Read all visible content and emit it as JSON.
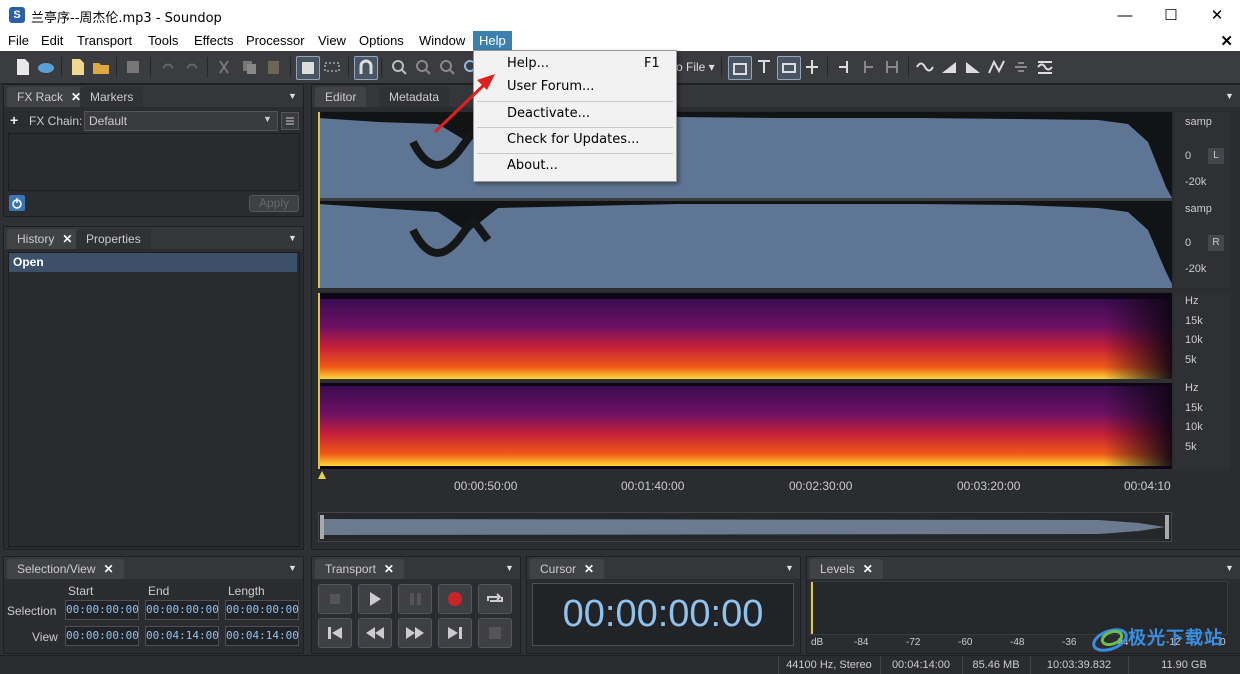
{
  "window": {
    "title": "兰亭序--周杰伦.mp3 - Soundop",
    "app_icon_letter": "S",
    "minimize_icon": "—",
    "maximize_icon": "☐",
    "close_icon": "✕"
  },
  "menubar": {
    "items": [
      "File",
      "Edit",
      "Transport",
      "Tools",
      "Effects",
      "Processor",
      "View",
      "Options",
      "Window",
      "Help"
    ],
    "close_icon": "✕"
  },
  "help_menu": {
    "items": [
      {
        "label": "Help...",
        "shortcut": "F1"
      },
      {
        "label": "User Forum...",
        "shortcut": ""
      },
      {
        "label": "Deactivate...",
        "shortcut": ""
      },
      {
        "label": "Check for Updates...",
        "shortcut": ""
      },
      {
        "label": "About...",
        "shortcut": ""
      }
    ]
  },
  "toolbar": {
    "partial_label": "o File ▾"
  },
  "fx_rack": {
    "tabs": [
      "FX Rack",
      "Markers"
    ],
    "chain_label": "FX Chain:",
    "chain_value": "Default",
    "apply_label": "Apply"
  },
  "history": {
    "tabs": [
      "History",
      "Properties"
    ],
    "items": [
      "Open"
    ]
  },
  "editor": {
    "tabs": [
      "Editor",
      "Metadata"
    ],
    "channels": [
      {
        "unit": "samp",
        "zero": "0",
        "low": "-20k",
        "badge": "L"
      },
      {
        "unit": "samp",
        "zero": "0",
        "low": "-20k",
        "badge": "R"
      }
    ],
    "spectrum_ticks": [
      "Hz",
      "15k",
      "10k",
      "5k"
    ],
    "timeline": [
      "00:00:50:00",
      "00:01:40:00",
      "00:02:30:00",
      "00:03:20:00",
      "00:04:10"
    ]
  },
  "selection_view": {
    "tab": "Selection/View",
    "headers": [
      "Start",
      "End",
      "Length"
    ],
    "rows": [
      {
        "label": "Selection",
        "values": [
          "00:00:00:00",
          "00:00:00:00",
          "00:00:00:00"
        ]
      },
      {
        "label": "View",
        "values": [
          "00:00:00:00",
          "00:04:14:00",
          "00:04:14:00"
        ]
      }
    ]
  },
  "transport": {
    "tab": "Transport"
  },
  "cursor": {
    "tab": "Cursor",
    "time": "00:00:00:00"
  },
  "levels": {
    "tab": "Levels",
    "scale": [
      "dB",
      "-84",
      "-72",
      "-60",
      "-48",
      "-36",
      "-24",
      "-12",
      "0"
    ]
  },
  "statusbar": [
    "44100 Hz, Stereo",
    "00:04:14:00",
    "85.46 MB",
    "10:03:39.832",
    "11.90 GB"
  ],
  "watermark": "极光下载站",
  "colors": {
    "accent": "#3c7fb1",
    "waveform": "#5f7594",
    "lcd_text": "#8fc2ee",
    "record": "#c8242a"
  }
}
